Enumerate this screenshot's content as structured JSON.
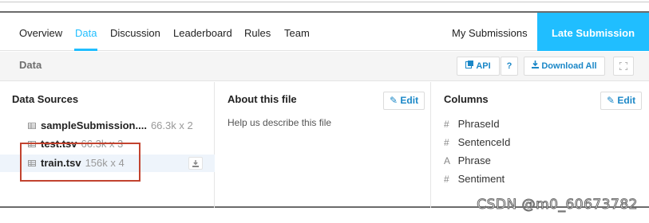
{
  "tabs": [
    {
      "label": "Overview",
      "active": false
    },
    {
      "label": "Data",
      "active": true
    },
    {
      "label": "Discussion",
      "active": false
    },
    {
      "label": "Leaderboard",
      "active": false
    },
    {
      "label": "Rules",
      "active": false
    },
    {
      "label": "Team",
      "active": false
    }
  ],
  "nav_right": {
    "my_submissions": "My Submissions",
    "late_submission": "Late Submission"
  },
  "header": {
    "title": "Data",
    "api_label": "API",
    "help_label": "?",
    "download_all_label": "Download All",
    "expand_icon": "expand-icon"
  },
  "data_sources": {
    "title": "Data Sources",
    "files": [
      {
        "name": "sampleSubmission....",
        "dims": "66.3k x 2",
        "selected": false
      },
      {
        "name": "test.tsv",
        "dims": "66.3k x 3",
        "selected": false
      },
      {
        "name": "train.tsv",
        "dims": "156k x 4",
        "selected": true
      }
    ]
  },
  "about": {
    "title": "About this file",
    "edit_label": "Edit",
    "description": "Help us describe this file"
  },
  "columns": {
    "title": "Columns",
    "edit_label": "Edit",
    "items": [
      {
        "type_icon": "#",
        "name": "PhraseId"
      },
      {
        "type_icon": "#",
        "name": "SentenceId"
      },
      {
        "type_icon": "A",
        "name": "Phrase"
      },
      {
        "type_icon": "#",
        "name": "Sentiment"
      }
    ]
  },
  "watermark": "CSDN @m0_60673782",
  "colors": {
    "accent": "#20beff",
    "link": "#1a87c7",
    "highlight_box": "#c2432f",
    "selected_row": "#eef4fb"
  }
}
